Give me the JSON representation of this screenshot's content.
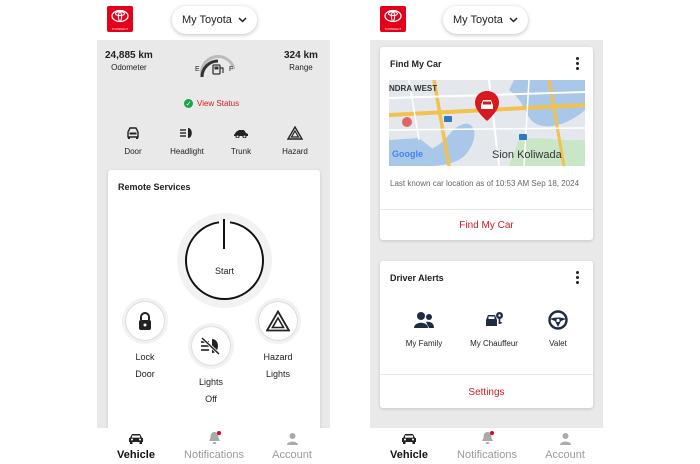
{
  "brand": {
    "logo_text": "TCONNECT",
    "accent": "#e3001b"
  },
  "left": {
    "vehicle_select": "My Toyota",
    "odometer": {
      "value": "24,885 km",
      "label": "Odometer"
    },
    "range": {
      "value": "324 km",
      "label": "Range"
    },
    "fuel": {
      "empty": "E",
      "full": "F"
    },
    "view_status": "View Status",
    "status_items": [
      {
        "label": "Door",
        "icon": "car-door-icon"
      },
      {
        "label": "Headlight",
        "icon": "headlight-icon"
      },
      {
        "label": "Trunk",
        "icon": "trunk-icon"
      },
      {
        "label": "Hazard",
        "icon": "hazard-icon"
      }
    ],
    "remote_services": {
      "title": "Remote Services",
      "start": "Start",
      "lock_line1": "Lock",
      "lock_line2": "Door",
      "lights_line1": "Lights",
      "lights_line2": "Off",
      "hazard_line1": "Hazard",
      "hazard_line2": "Lights"
    },
    "nav": [
      {
        "label": "Vehicle",
        "active": true
      },
      {
        "label": "Notifications",
        "active": false
      },
      {
        "label": "Account",
        "active": false
      }
    ]
  },
  "right": {
    "vehicle_select": "My Toyota",
    "find_my_car": {
      "title": "Find My Car",
      "map_label_1": "NDRA WEST",
      "map_label_2": "Sion Koliwada",
      "map_brand": "Google",
      "last_known": "Last known car location as of 10:53 AM Sep 18, 2024",
      "link": "Find My Car"
    },
    "driver_alerts": {
      "title": "Driver Alerts",
      "items": [
        {
          "label": "My Family",
          "icon": "family-icon"
        },
        {
          "label": "My Chauffeur",
          "icon": "chauffeur-icon"
        },
        {
          "label": "Valet",
          "icon": "steering-wheel-icon"
        }
      ],
      "link": "Settings"
    },
    "nav": [
      {
        "label": "Vehicle",
        "active": true
      },
      {
        "label": "Notifications",
        "active": false
      },
      {
        "label": "Account",
        "active": false
      }
    ]
  }
}
